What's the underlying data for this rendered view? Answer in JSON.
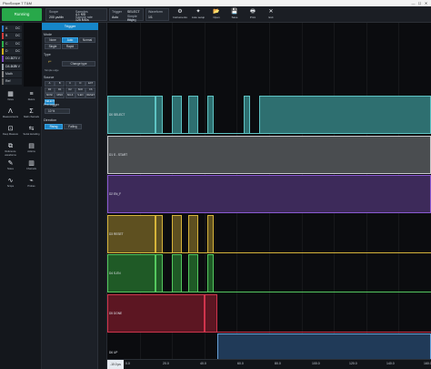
{
  "window": {
    "title": "PicoScope 7 T&M",
    "controls": [
      "—",
      "☐",
      "✕"
    ]
  },
  "toolbar": {
    "run_label": "Running",
    "scope": {
      "label": "Scope",
      "timebase": "200 µs/div",
      "s1": "Samples",
      "s2": "4.1 MS",
      "s3": "Sample rate",
      "s4": "125 MS/s"
    },
    "trigger": {
      "label": "Trigger",
      "mode": "SELECT",
      "edge": "Auto",
      "s1": "Simple edge",
      "s2": "Rising"
    },
    "waveform": {
      "label": "Waveform",
      "value": "1/1"
    },
    "buttons": [
      {
        "label": "Instruments",
        "icon": "⚙"
      },
      {
        "label": "Auto setup",
        "icon": "✦"
      },
      {
        "label": "Open",
        "icon": "📂"
      },
      {
        "label": "Save",
        "icon": "💾"
      },
      {
        "label": "Print",
        "icon": "🖶"
      },
      {
        "label": "Exit",
        "icon": "✕"
      }
    ]
  },
  "channels": [
    {
      "name": "A",
      "value": "DC",
      "color": "#2a78c8"
    },
    {
      "name": "B",
      "value": "DC",
      "color": "#d43b3b"
    },
    {
      "name": "C",
      "value": "DC",
      "color": "#2cb048"
    },
    {
      "name": "D",
      "value": "DC",
      "color": "#d0b020"
    },
    {
      "name": "D0-D7",
      "value": "3.75 V",
      "color": "#7c4ac2"
    },
    {
      "name": "D8-D15",
      "value": "3.75 V",
      "color": "#9aa3ad"
    },
    {
      "name": "Math",
      "value": "",
      "color": "#888888"
    },
    {
      "name": "Ref",
      "value": "",
      "color": "#666666"
    }
  ],
  "tools": [
    {
      "label": "Views",
      "icon": "▦"
    },
    {
      "label": "Rulers",
      "icon": "≡"
    },
    {
      "label": "Measurements",
      "icon": "Λ"
    },
    {
      "label": "Math channels",
      "icon": "Σ"
    },
    {
      "label": "Deep Measure",
      "icon": "⊡"
    },
    {
      "label": "Serial decoding",
      "icon": "⇆"
    },
    {
      "label": "Reference waveforms",
      "icon": "⧉"
    },
    {
      "label": "Actions",
      "icon": "▤"
    },
    {
      "label": "Notes",
      "icon": "✎"
    },
    {
      "label": "Channels",
      "icon": "▥"
    },
    {
      "label": "Scope",
      "icon": "∿"
    },
    {
      "label": "Probes",
      "icon": "⌁"
    }
  ],
  "trigger_panel": {
    "header": "Trigger",
    "mode_label": "Mode",
    "modes": [
      "None",
      "Auto",
      "Normal",
      "Single",
      "Rapid"
    ],
    "type_label": "Type",
    "type_name": "Simple edge",
    "change_type": "Change type",
    "source_label": "Source",
    "sources": [
      "A",
      "B",
      "C",
      "D",
      "EXT",
      "D0",
      "D1",
      "D2",
      "SCK",
      "CS",
      "MOSI",
      "MISO",
      "SCLK",
      "S-EN",
      "RESET",
      "SELECT"
    ],
    "selected_source": "SELECT",
    "pretrigger_label": "Pre-trigger",
    "pretrigger_value": "10 %",
    "direction_label": "Direction",
    "directions": [
      "Rising",
      "Falling"
    ],
    "selected_direction": "Rising"
  },
  "lanes": [
    {
      "label": "D0 SELECT",
      "color": "#5ec3c3",
      "fill": "#2e6f70"
    },
    {
      "label": "D1 S - START",
      "color": "#c8cacc",
      "fill": "#4a4d50"
    },
    {
      "label": "D2 EN_F",
      "color": "#8a5ad2",
      "fill": "#3d2a5a"
    },
    {
      "label": "D3 RESET",
      "color": "#d6b43a",
      "fill": "#5e5020"
    },
    {
      "label": "D4 S-EN",
      "color": "#54c85e",
      "fill": "#1f5a26"
    },
    {
      "label": "D5 DONE",
      "color": "#d0344c",
      "fill": "#5c1622"
    },
    {
      "label": "D6 UP",
      "color": "#6aa4dc",
      "fill": "#203a58"
    }
  ],
  "xaxis": {
    "ticks": [
      "0.0",
      "20.0",
      "40.0",
      "60.0",
      "80.0",
      "100.0",
      "120.0",
      "140.0",
      "160.0"
    ],
    "marker": "-10.0 µs"
  },
  "chart_data": {
    "type": "line",
    "xlabel": "",
    "ylabel": "",
    "series": [
      {
        "name": "D0 SELECT",
        "x": [
          0,
          15,
          17,
          20,
          23,
          25,
          28,
          31,
          33,
          42,
          44,
          47,
          100
        ],
        "y": [
          1,
          1,
          0,
          1,
          0,
          1,
          0,
          1,
          0,
          1,
          0,
          1,
          1
        ]
      },
      {
        "name": "D1 S - START",
        "x": [
          0,
          100
        ],
        "y": [
          1,
          1
        ]
      },
      {
        "name": "D2 EN_F",
        "x": [
          0,
          100
        ],
        "y": [
          1,
          1
        ]
      },
      {
        "name": "D3 RESET",
        "x": [
          0,
          15,
          17,
          20,
          23,
          25,
          28,
          31,
          33,
          100
        ],
        "y": [
          1,
          1,
          0,
          1,
          0,
          1,
          0,
          1,
          0,
          1
        ]
      },
      {
        "name": "D4 S-EN",
        "x": [
          0,
          15,
          17,
          20,
          23,
          25,
          28,
          31,
          33,
          100
        ],
        "y": [
          1,
          1,
          0,
          1,
          0,
          1,
          0,
          1,
          0,
          1
        ]
      },
      {
        "name": "D5 DONE",
        "x": [
          0,
          30,
          34,
          100
        ],
        "y": [
          1,
          1,
          0,
          1
        ]
      },
      {
        "name": "D6 UP",
        "x": [
          0,
          30,
          34,
          100
        ],
        "y": [
          0,
          0,
          1,
          1
        ]
      }
    ]
  }
}
